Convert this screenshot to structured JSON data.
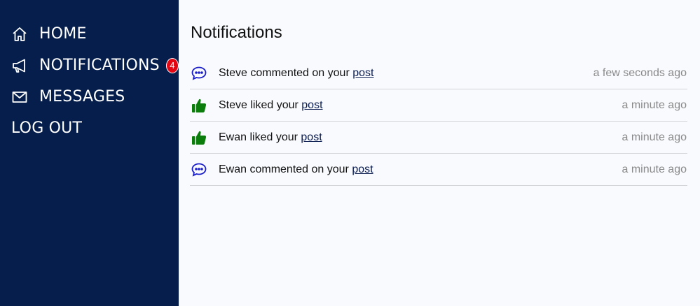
{
  "sidebar": {
    "items": [
      {
        "label": "HOME",
        "icon": "home-icon"
      },
      {
        "label": "NOTIFICATIONS",
        "icon": "megaphone-icon",
        "badge": "4"
      },
      {
        "label": "MESSAGES",
        "icon": "envelope-icon"
      },
      {
        "label": "LOG OUT"
      }
    ]
  },
  "main": {
    "title": "Notifications",
    "notifications": [
      {
        "icon": "comment-icon",
        "text": "Steve commented on your ",
        "link": "post",
        "time": "a few seconds ago"
      },
      {
        "icon": "thumbs-up-icon",
        "text": "Steve liked your ",
        "link": "post",
        "time": "a minute ago"
      },
      {
        "icon": "thumbs-up-icon",
        "text": "Ewan liked your ",
        "link": "post",
        "time": "a minute ago"
      },
      {
        "icon": "comment-icon",
        "text": "Ewan commented on your ",
        "link": "post",
        "time": "a minute ago"
      }
    ]
  },
  "colors": {
    "sidebar_bg": "#051e4b",
    "badge": "#e30613",
    "comment_icon": "#1a1ec9",
    "like_icon": "#0b7d0b",
    "link": "#0b1d51"
  }
}
